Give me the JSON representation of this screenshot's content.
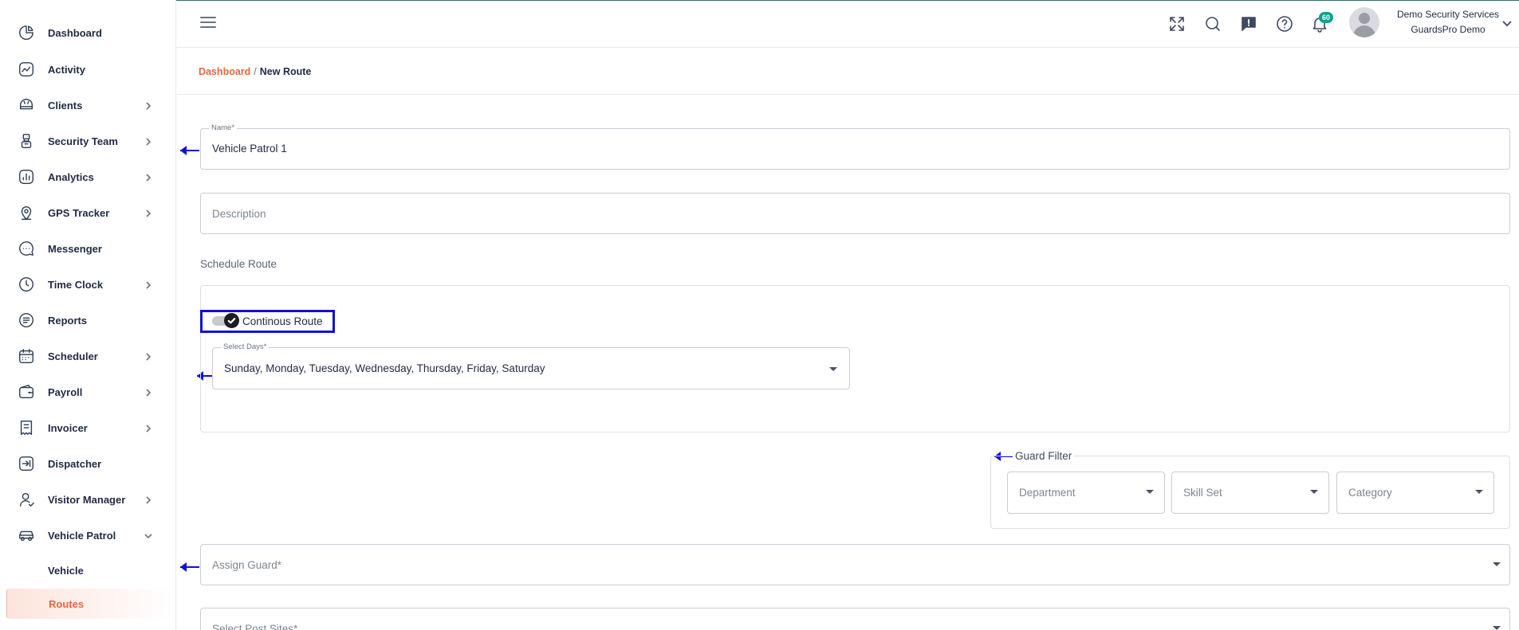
{
  "sidebar": {
    "items": [
      {
        "label": "Dashboard",
        "icon": "dashboard-icon"
      },
      {
        "label": "Activity",
        "icon": "activity-icon"
      },
      {
        "label": "Clients",
        "icon": "clients-icon"
      },
      {
        "label": "Security Team",
        "icon": "security-team-icon"
      },
      {
        "label": "Analytics",
        "icon": "analytics-icon"
      },
      {
        "label": "GPS Tracker",
        "icon": "gps-tracker-icon"
      },
      {
        "label": "Messenger",
        "icon": "messenger-icon"
      },
      {
        "label": "Time Clock",
        "icon": "time-clock-icon"
      },
      {
        "label": "Reports",
        "icon": "reports-icon"
      },
      {
        "label": "Scheduler",
        "icon": "scheduler-icon"
      },
      {
        "label": "Payroll",
        "icon": "payroll-icon"
      },
      {
        "label": "Invoicer",
        "icon": "invoicer-icon"
      },
      {
        "label": "Dispatcher",
        "icon": "dispatcher-icon"
      },
      {
        "label": "Visitor Manager",
        "icon": "visitor-manager-icon"
      },
      {
        "label": "Vehicle Patrol",
        "icon": "vehicle-patrol-icon"
      }
    ],
    "sub_items": [
      {
        "label": "Vehicle"
      },
      {
        "label": "Routes"
      }
    ],
    "active_color": "#e8673c"
  },
  "header": {
    "notification_count": "60",
    "user_name": "Demo Security Services",
    "user_org": "GuardsPro Demo",
    "icons": [
      "fullscreen-icon",
      "search-icon",
      "feedback-icon",
      "help-icon",
      "bell-icon"
    ]
  },
  "breadcrumb": {
    "link": "Dashboard",
    "separator": "/",
    "current": "New Route"
  },
  "form": {
    "name_legend": "Name*",
    "name_value": "Vehicle Patrol 1",
    "description_placeholder": "Description",
    "schedule_title": "Schedule Route",
    "continuous_label": "Continous Route",
    "continuous_on": true,
    "days_legend": "Select Days*",
    "days_value": "Sunday, Monday, Tuesday, Wednesday, Thursday, Friday, Saturday",
    "guard_filter_title": "Guard Filter",
    "department_placeholder": "Department",
    "skillset_placeholder": "Skill Set",
    "category_placeholder": "Category",
    "assign_guard_placeholder": "Assign Guard*",
    "post_sites_placeholder": "Select Post Sites*"
  },
  "colors": {
    "accent": "#e8673c",
    "annotation": "#1010d8",
    "badge": "#0e9f8f"
  }
}
